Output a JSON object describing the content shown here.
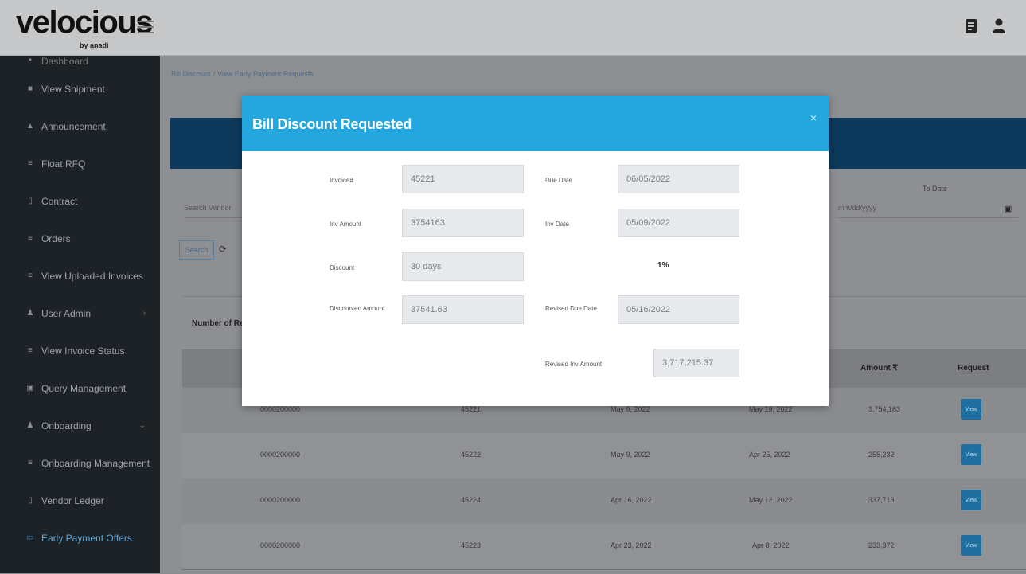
{
  "brand": {
    "name": "velocious",
    "tagline": "by anadi",
    "accent": "#24a6df"
  },
  "header": {
    "menu_icon": "hamburger-icon",
    "icons": [
      "document-icon",
      "user-icon"
    ]
  },
  "sidebar": {
    "partial_item": {
      "label": "Dashboard",
      "icon": "dashboard-icon"
    },
    "items": [
      {
        "label": "View Shipment",
        "icon": "truck-icon"
      },
      {
        "label": "Announcement",
        "icon": "megaphone-icon"
      },
      {
        "label": "Float RFQ",
        "icon": "list-icon"
      },
      {
        "label": "Contract",
        "icon": "file-icon"
      },
      {
        "label": "Orders",
        "icon": "cart-icon"
      },
      {
        "label": "View Uploaded Invoices",
        "icon": "upload-icon"
      },
      {
        "label": "User Admin",
        "icon": "user-icon",
        "has_children": true
      },
      {
        "label": "View Invoice Status",
        "icon": "status-icon"
      },
      {
        "label": "Query Management",
        "icon": "query-icon"
      },
      {
        "label": "Onboarding",
        "icon": "onboarding-icon",
        "has_children": true
      },
      {
        "label": "Onboarding Management",
        "icon": "settings-icon"
      },
      {
        "label": "Vendor Ledger",
        "icon": "ledger-icon"
      },
      {
        "label": "Early Payment Offers",
        "icon": "offer-icon",
        "active": true
      }
    ]
  },
  "main": {
    "breadcrumb": {
      "root": "Bill Discount",
      "separator": "/",
      "current": "View Early Payment Requests"
    },
    "filters": {
      "search_placeholder": "Search Vendor",
      "to_date_label": "To Date",
      "to_date_placeholder": "mm/dd/yyyy",
      "search_button": "Search"
    },
    "table": {
      "records_label": "Number of Records",
      "headers": {
        "amount": "Amount ₹",
        "request": "Request"
      },
      "view_label": "View",
      "rows": [
        {
          "vendor": "0000200000",
          "invoice": "45221",
          "invoice_date": "May 9, 2022",
          "due_date": "May 19, 2022",
          "amount": "3,754,163"
        },
        {
          "vendor": "0000200000",
          "invoice": "45222",
          "invoice_date": "May 9, 2022",
          "due_date": "Apr 25, 2022",
          "amount": "255,232"
        },
        {
          "vendor": "0000200000",
          "invoice": "45224",
          "invoice_date": "Apr 16, 2022",
          "due_date": "May 12, 2022",
          "amount": "337,713"
        },
        {
          "vendor": "0000200000",
          "invoice": "45223",
          "invoice_date": "Apr 23, 2022",
          "due_date": "Apr 8, 2022",
          "amount": "233,372"
        }
      ]
    }
  },
  "modal": {
    "title": "Bill Discount Requested",
    "close": "×",
    "fields": {
      "invoice_label": "Invoice#",
      "invoice_value": "45221",
      "due_date_label": "Due Date",
      "due_date_value": "06/05/2022",
      "inv_amount_label": "Inv Amount",
      "inv_amount_value": "3754163",
      "inv_date_label": "Inv Date",
      "inv_date_value": "05/09/2022",
      "discount_label": "Discount",
      "discount_value": "30 days",
      "percent": "1%",
      "discounted_amount_label": "Discounted Amount",
      "discounted_amount_value": "37541.63",
      "revised_due_date_label": "Revised Due Date",
      "revised_due_date_value": "05/16/2022",
      "revised_inv_amount_label": "Revised Inv Amount",
      "revised_inv_amount_value": "3,717,215.37"
    }
  }
}
